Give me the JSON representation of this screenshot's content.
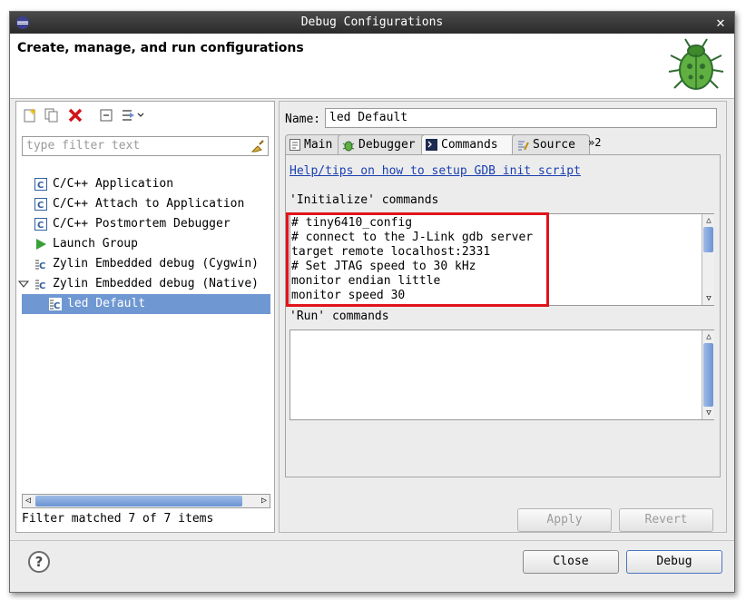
{
  "window": {
    "title": "Debug Configurations"
  },
  "header": {
    "title": "Create, manage, and run configurations"
  },
  "left_panel": {
    "filter_placeholder": "type filter text",
    "tree": [
      {
        "label": "C/C++ Application",
        "icon": "c-app-icon"
      },
      {
        "label": "C/C++ Attach to Application",
        "icon": "c-attach-icon"
      },
      {
        "label": "C/C++ Postmortem Debugger",
        "icon": "c-postmortem-icon"
      },
      {
        "label": "Launch Group",
        "icon": "launch-group-icon"
      },
      {
        "label": "Zylin Embedded debug (Cygwin)",
        "icon": "zylin-icon"
      },
      {
        "label": "Zylin Embedded debug (Native)",
        "icon": "zylin-icon",
        "expanded": true
      },
      {
        "label": "led Default",
        "icon": "zylin-config-icon",
        "selected": true
      }
    ],
    "status": "Filter matched 7 of 7 items"
  },
  "right_panel": {
    "name_label": "Name:",
    "name_value": "led Default",
    "tabs": [
      {
        "label": "Main",
        "icon": "main-tab-icon"
      },
      {
        "label": "Debugger",
        "icon": "debugger-tab-icon"
      },
      {
        "label": "Commands",
        "icon": "commands-tab-icon",
        "active": true
      },
      {
        "label": "Source",
        "icon": "source-tab-icon"
      }
    ],
    "more_tabs": "»2",
    "help_link": "Help/tips on how to setup GDB init script",
    "init_label": "'Initialize' commands",
    "init_commands": "# tiny6410_config\n# connect to the J-Link gdb server\ntarget remote localhost:2331\n# Set JTAG speed to 30 kHz\nmonitor endian little\nmonitor speed 30",
    "run_label": "'Run' commands",
    "run_commands": "",
    "apply_label": "Apply",
    "revert_label": "Revert"
  },
  "footer": {
    "help_label": "?",
    "close_label": "Close",
    "debug_label": "Debug"
  },
  "colors": {
    "selection": "#6f97d2",
    "highlight_box": "#e0141a",
    "link": "#1a3fb0"
  }
}
